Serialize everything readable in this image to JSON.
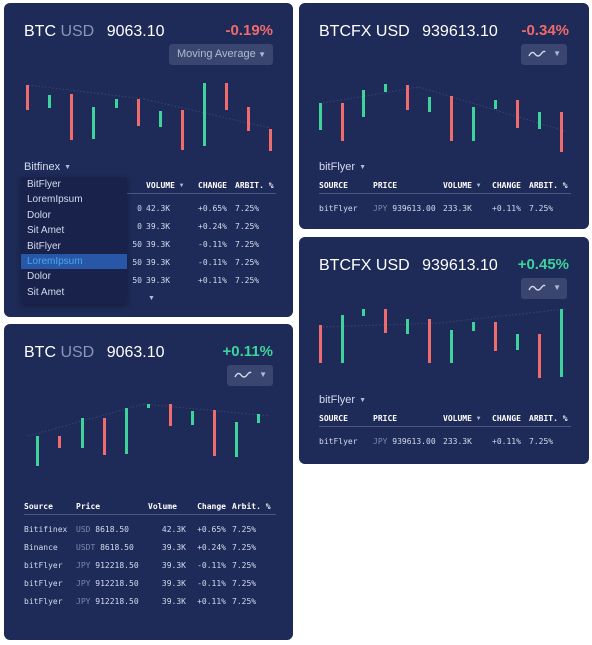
{
  "colors": {
    "card_bg": "#1e2a57",
    "positive": "#3ed39b",
    "negative": "#f06b6b",
    "menu_active_bg": "#2857a8",
    "menu_active_text": "#47a8f2"
  },
  "icons": {
    "dropdown": "caret-down-icon",
    "indicator": "sine-wave-icon"
  },
  "card_a": {
    "base": "BTC",
    "quote": "USD",
    "price": "9063.10",
    "change": "-0.19%",
    "indicator_label": "Moving Average",
    "exchange": "Bitfinex",
    "menu_items": [
      "BitFlyer",
      "LoremIpsum",
      "Dolor",
      "Sit Amet",
      "BitFlyer",
      "LoremIpsum",
      "Dolor",
      "Sit Amet"
    ],
    "menu_active_index": 5,
    "columns": {
      "volume": "VOLUME",
      "change": "CHANGE",
      "arbit": "ARBIT. %"
    },
    "rows": [
      {
        "price_tail": "0",
        "volume": "42.3K",
        "change": "+0.65%",
        "arbit": "7.25%"
      },
      {
        "price_tail": "0",
        "volume": "39.3K",
        "change": "+0.24%",
        "arbit": "7.25%"
      },
      {
        "price_tail": "50",
        "volume": "39.3K",
        "change": "-0.11%",
        "arbit": "7.25%"
      },
      {
        "price_tail": "50",
        "volume": "39.3K",
        "change": "-0.11%",
        "arbit": "7.25%"
      },
      {
        "price_tail": "50",
        "volume": "39.3K",
        "change": "+0.11%",
        "arbit": "7.25%"
      }
    ]
  },
  "card_b": {
    "title": "BTCFX USD",
    "price": "939613.10",
    "change": "-0.34%",
    "exchange": "bitFlyer",
    "columns": {
      "source": "SOURCE",
      "price": "PRICE",
      "volume": "VOLUME",
      "change": "CHANGE",
      "arbit": "ARBIT. %"
    },
    "rows": [
      {
        "source": "bitFlyer",
        "currency": "JPY",
        "price": "939613.00",
        "volume": "233.3K",
        "change": "+0.11%",
        "arbit": "7.25%"
      }
    ]
  },
  "card_c": {
    "title": "BTCFX USD",
    "price": "939613.10",
    "change": "+0.45%",
    "exchange": "bitFlyer",
    "columns": {
      "source": "SOURCE",
      "price": "PRICE",
      "volume": "VOLUME",
      "change": "CHANGE",
      "arbit": "ARBIT. %"
    },
    "rows": [
      {
        "source": "bitFlyer",
        "currency": "JPY",
        "price": "939613.00",
        "volume": "233.3K",
        "change": "+0.11%",
        "arbit": "7.25%"
      }
    ]
  },
  "card_d": {
    "base": "BTC",
    "quote": "USD",
    "price": "9063.10",
    "change": "+0.11%",
    "columns": {
      "source": "Source",
      "price": "Price",
      "volume": "Volume",
      "change": "Change",
      "arbit": "Arbit. %"
    },
    "rows": [
      {
        "source": "Bitifinex",
        "currency": "USD",
        "price": "8618.50",
        "volume": "42.3K",
        "change": "+0.65%",
        "arbit": "7.25%"
      },
      {
        "source": "Binance",
        "currency": "USDT",
        "price": "8618.50",
        "volume": "39.3K",
        "change": "+0.24%",
        "arbit": "7.25%"
      },
      {
        "source": "bitFlyer",
        "currency": "JPY",
        "price": "912218.50",
        "volume": "39.3K",
        "change": "-0.11%",
        "arbit": "7.25%"
      },
      {
        "source": "bitFlyer",
        "currency": "JPY",
        "price": "912218.50",
        "volume": "39.3K",
        "change": "-0.11%",
        "arbit": "7.25%"
      },
      {
        "source": "bitFlyer",
        "currency": "JPY",
        "price": "912218.50",
        "volume": "39.3K",
        "change": "+0.11%",
        "arbit": "7.25%"
      }
    ]
  }
}
